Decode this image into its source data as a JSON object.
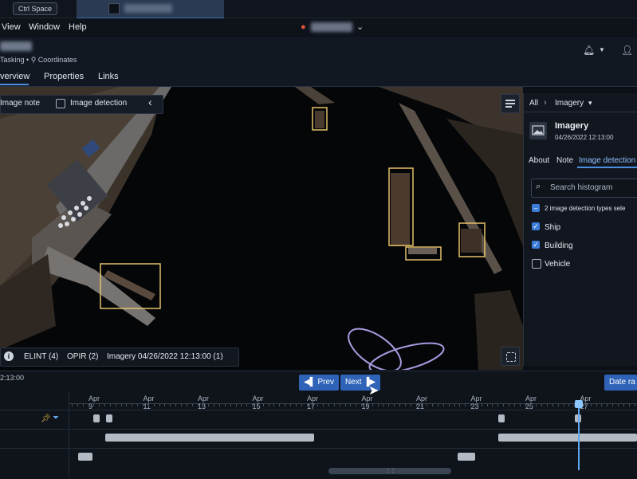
{
  "topbar": {
    "shortcut": "Ctrl Space"
  },
  "menubar": {
    "items": [
      "View",
      "Window",
      "Help"
    ]
  },
  "header": {
    "breadcrumb_a": "Tasking",
    "breadcrumb_b": "Coordinates",
    "tabs": [
      "verview",
      "Properties",
      "Links"
    ]
  },
  "map_toolbar": {
    "image_note": "Image note",
    "image_detection": "Image detection",
    "collapse": "‹"
  },
  "status": {
    "info": "i",
    "elint": "ELINT (4)",
    "opir": "OPIR (2)",
    "imagery": "Imagery 04/26/2022 12:13:00 (1)"
  },
  "panel": {
    "crumb_all": "All",
    "crumb_sep": "›",
    "crumb_imagery": "Imagery",
    "crumb_caret": "▾",
    "title": "Imagery",
    "timestamp": "04/26/2022 12:13:00",
    "tabs": [
      "About",
      "Note",
      "Image detection"
    ],
    "search_placeholder": "Search histogram",
    "types_selected": "2 image detection types sele",
    "options": [
      {
        "label": "Ship",
        "checked": true
      },
      {
        "label": "Building",
        "checked": true
      },
      {
        "label": "Vehicle",
        "checked": false
      }
    ]
  },
  "timeline": {
    "left_time": "2:13:00",
    "prev": "Prev",
    "next": "Next",
    "date_range": "Date ra",
    "ticks": [
      "Apr 9",
      "Apr 11",
      "Apr 13",
      "Apr 15",
      "Apr 17",
      "Apr 19",
      "Apr 21",
      "Apr 23",
      "Apr 25",
      "Apr 27"
    ]
  },
  "colors": {
    "accent": "#2f63b8",
    "detection_box": "#e5c06a",
    "now_line": "#5ea8f0"
  }
}
